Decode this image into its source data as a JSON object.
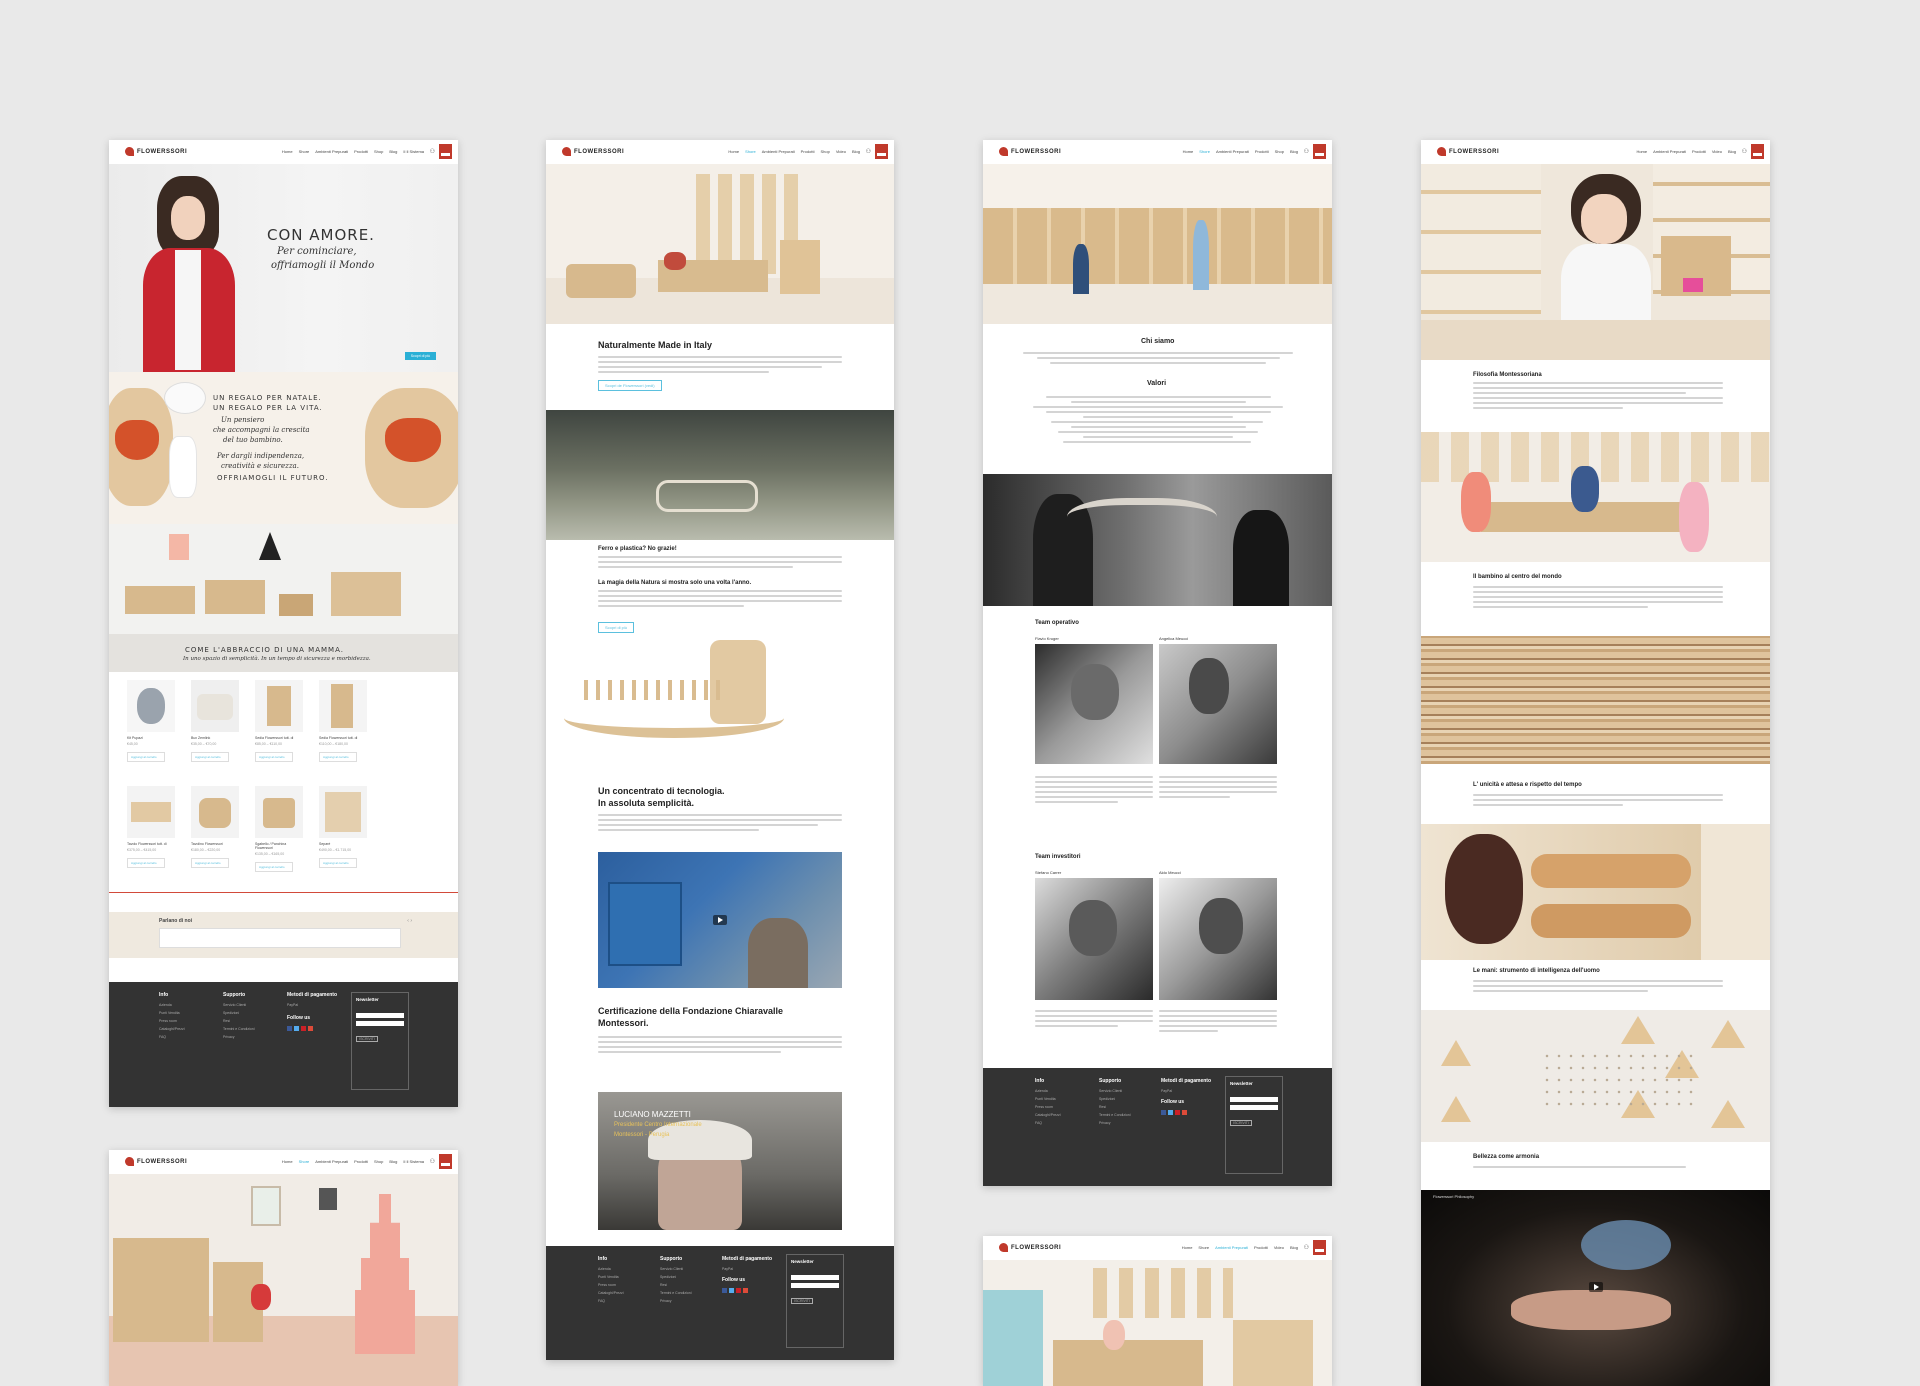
{
  "brand": {
    "name": "FLOWERSSORI"
  },
  "nav": {
    "p1": [
      "Home",
      "Shore",
      "Ambienti Prepurati",
      "Prodotti",
      "Shop",
      "Video",
      "Blog",
      "Il Il Sistema"
    ],
    "p2": [
      "Home",
      "Shore",
      "Ambienti Prepurati",
      "Prodotti",
      "Shop",
      "Video",
      "Blog",
      "Il Il Sistema"
    ],
    "p3": [
      "Home",
      "Shore",
      "Ambienti Prepurati",
      "Prodotti",
      "Shop",
      "Video",
      "Blog",
      "Il Il Sistema"
    ],
    "p4": [
      "Home",
      "Shore",
      "Ambienti Prepurati",
      "Prodotti",
      "Shop",
      "Video",
      "Blog",
      "Il Il Sistema"
    ]
  },
  "home": {
    "hero_title": "CON AMORE.",
    "hero_line1": "Per cominciare,",
    "hero_line2": "offriamogli il Mondo",
    "hero_button": "Scopri di più",
    "gift_caps1": "UN REGALO PER NATALE.",
    "gift_caps2": "UN REGALO PER LA VITA.",
    "gift_hand1": "Un pensiero",
    "gift_hand2": "che accompagni la crescita",
    "gift_hand3": "del tuo bambino.",
    "gift_hand4": "Per dargli indipendenza,",
    "gift_hand5": "creatività e sicurezza.",
    "gift_caps3": "OFFRIAMOGLI IL FUTURO.",
    "room_caps": "COME L'ABBRACCIO DI UNA MAMMA.",
    "room_hand": "In uno spazio di semplicità. In un tempo di sicurezza e morbidezza.",
    "products": [
      {
        "name": "Kit Pupazi",
        "price": "€45,00",
        "add": "Aggiungi al carrello"
      },
      {
        "name": "Bux Zemlink",
        "price": "€35,00 – €70,00",
        "add": "Aggiungi al carrello"
      },
      {
        "name": "Sedia Flowerssori tutt. di",
        "price": "€85,00 – €110,00",
        "add": "Aggiungi al carrello"
      },
      {
        "name": "Sedia Flowerssori tutt. di",
        "price": "€110,00 – €180,00",
        "add": "Aggiungi al carrello"
      },
      {
        "name": "Tavolo Flowerssori tutt. di",
        "price": "€375,00 – €415,00",
        "add": "Aggiungi al carrello"
      },
      {
        "name": "Tavolino Flowerssori",
        "price": "€180,00 – €220,00",
        "add": "Aggiungi al carrello"
      },
      {
        "name": "Sgabello / Panchina Flowerssori",
        "price": "€135,00 – €165,00",
        "add": "Aggiungi al carrello"
      },
      {
        "name": "Separè",
        "price": "€490,00 – €1.715,00",
        "add": "Aggiungi al carrello"
      }
    ],
    "testimonial_title": "Parlano di noi"
  },
  "footer": {
    "col1_title": "Info",
    "col1": [
      "Azienda",
      "Punti Vendita",
      "Press room",
      "Cataloghi/Prezzi",
      "FAQ"
    ],
    "col2_title": "Supporto",
    "col2": [
      "Servizio Clienti",
      "Spedizioni",
      "Resi",
      "Termini e Condizioni",
      "Privacy"
    ],
    "col3_title": "Metodi di pagamento",
    "col3b_title": "Follow us",
    "newsletter_title": "Newsletter",
    "newsletter_btn": "ISCRIVITI",
    "paypal": "PayPal"
  },
  "about": {
    "title1": "Naturalmente Made in Italy",
    "btn1": "Scopri de Flowerssori (vedi)",
    "title2": "Ferro e plastica? No grazie!",
    "title3": "La magia della Natura si mostra solo una volta l'anno.",
    "btn2": "Scopri di più",
    "title4a": "Un concentrato di tecnologia.",
    "title4b": "In assoluta semplicità.",
    "title5a": "Certificazione della Fondazione Chiaravalle",
    "title5b": "Montessori.",
    "video_name": "LUCIANO MAZZETTI",
    "video_role1": "Presidente Centro Internazionale",
    "video_role2": "Montessori - Perugia"
  },
  "team": {
    "title_chi": "Chi siamo",
    "title_valori": "Valori",
    "team_op": "Team operativo",
    "op1": "Flavio Kruger",
    "op2": "Angelica Meucci",
    "team_inv": "Team investitori",
    "inv1": "Stefano Carrer",
    "inv2": "Aldo Meucci"
  },
  "philosophy": {
    "t1": "Filosofia Montessoriana",
    "t2": "Il bambino al centro del mondo",
    "t3": "L' unicità e attesa e rispetto del tempo",
    "t4": "Le mani: strumento di intelligenza dell'uomo",
    "t5": "Bellezza come armonia",
    "video_channel": "Flowerssori Philosophy"
  },
  "colors": {
    "accent": "#2bb0d6",
    "brand": "#c0392b",
    "footer": "#333333",
    "wood": "#d7b98d"
  }
}
